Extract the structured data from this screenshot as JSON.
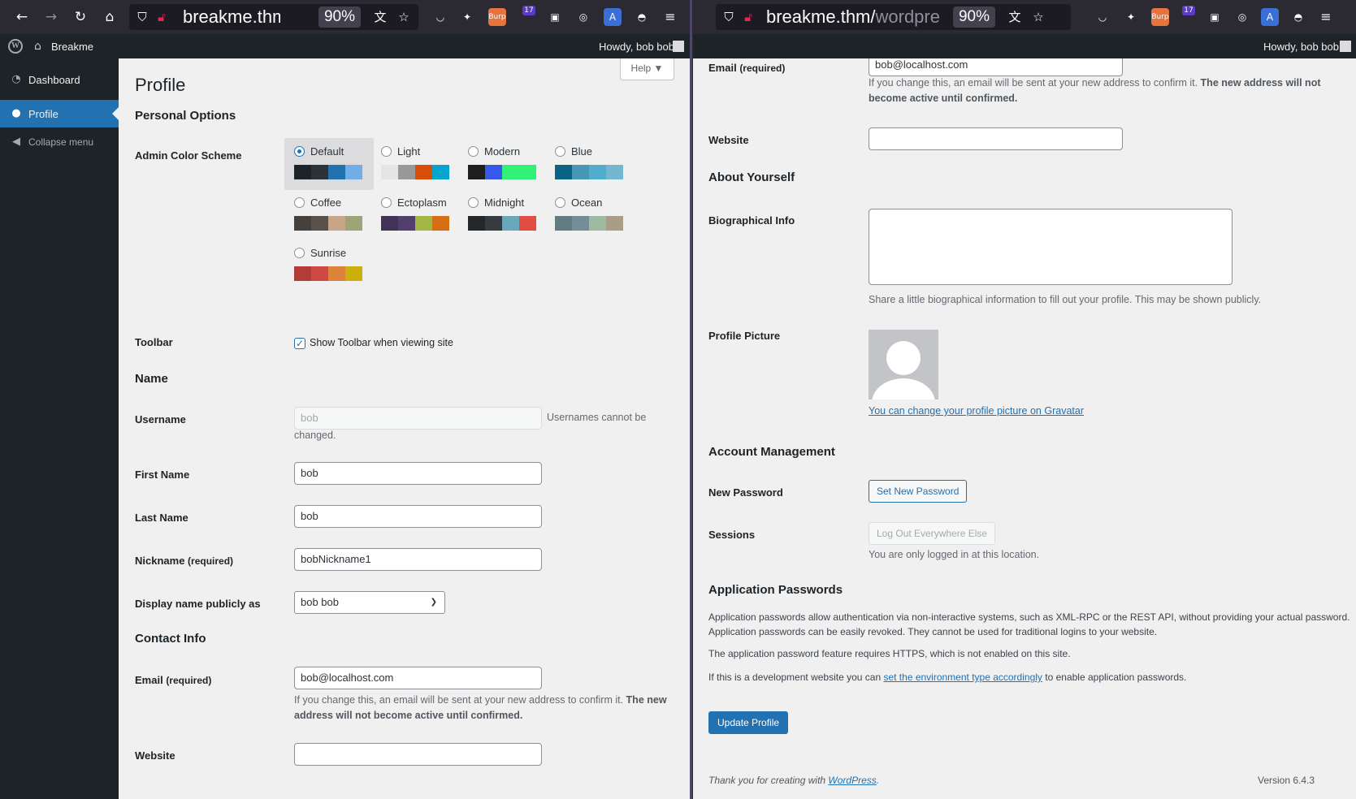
{
  "browser": {
    "left_url_host": "breakme.thm/",
    "left_url_path": "v",
    "right_url_host": "breakme.thm/",
    "right_url_path": "wordpre",
    "zoom": "90%",
    "ext_burp": "Burp",
    "ext_badge": "17"
  },
  "adminbar": {
    "site_name": "Breakme",
    "howdy": "Howdy, bob bob"
  },
  "sidebar": {
    "items": [
      {
        "label": "Dashboard"
      },
      {
        "label": "Profile"
      },
      {
        "label": "Collapse menu"
      }
    ]
  },
  "help_tab": "Help ▼",
  "page": {
    "title": "Profile",
    "section_personal": "Personal Options",
    "label_color_scheme": "Admin Color Scheme",
    "color_schemes": [
      {
        "name": "Default",
        "selected": true,
        "colors": [
          "#1d2327",
          "#2c3338",
          "#2271b1",
          "#72aee6"
        ]
      },
      {
        "name": "Light",
        "selected": false,
        "colors": [
          "#e5e5e5",
          "#999999",
          "#d64e07",
          "#04a4cc"
        ]
      },
      {
        "name": "Modern",
        "selected": false,
        "colors": [
          "#1e1e1e",
          "#3858e9",
          "#33f078",
          "#33f078"
        ]
      },
      {
        "name": "Blue",
        "selected": false,
        "colors": [
          "#096484",
          "#4796b3",
          "#52accc",
          "#74b6ce"
        ]
      },
      {
        "name": "Coffee",
        "selected": false,
        "colors": [
          "#46403c",
          "#59524c",
          "#c7a589",
          "#9ea476"
        ]
      },
      {
        "name": "Ectoplasm",
        "selected": false,
        "colors": [
          "#413256",
          "#523f6d",
          "#a3b745",
          "#d46f15"
        ]
      },
      {
        "name": "Midnight",
        "selected": false,
        "colors": [
          "#25282b",
          "#363b3f",
          "#69a8bb",
          "#e14d43"
        ]
      },
      {
        "name": "Ocean",
        "selected": false,
        "colors": [
          "#627c83",
          "#738e96",
          "#9ebaa0",
          "#aa9d88"
        ]
      },
      {
        "name": "Sunrise",
        "selected": false,
        "colors": [
          "#b43c38",
          "#cf4944",
          "#dd823b",
          "#ccaf0b"
        ]
      }
    ],
    "label_toolbar": "Toolbar",
    "toolbar_checkbox_label": "Show Toolbar when viewing site",
    "section_name": "Name",
    "label_username": "Username",
    "username_value": "bob",
    "username_note_1": "Usernames cannot be",
    "username_note_2": "changed.",
    "label_first_name": "First Name",
    "first_name_value": "bob",
    "label_last_name": "Last Name",
    "last_name_value": "bob",
    "label_nickname": "Nickname",
    "required": "(required)",
    "nickname_value": "bobNickname1",
    "label_display_name": "Display name publicly as",
    "display_name_value": "bob bob",
    "section_contact": "Contact Info",
    "label_email": "Email",
    "email_value": "bob@localhost.com",
    "email_note_plain": "If you change this, an email will be sent at your new address to confirm it.",
    "email_note_bold": "The new address will not become active until confirmed.",
    "email_note_left_1": "If you change this, an email will be sent at your new address to confirm it.",
    "email_note_left_bold_1": "The new",
    "email_note_left_bold_2": "address will not become active until confirmed.",
    "email_note_right_1": "If you change this, an email will be sent at your new address to confirm it.",
    "email_note_right_bold_1": "The new address will not",
    "email_note_right_bold_2": "become active until confirmed.",
    "label_website": "Website",
    "website_value": "",
    "section_about": "About Yourself",
    "label_bio": "Biographical Info",
    "bio_note": "Share a little biographical information to fill out your profile. This may be shown publicly.",
    "label_picture": "Profile Picture",
    "gravatar_link": "You can change your profile picture on Gravatar",
    "section_account": "Account Management",
    "label_new_password": "New Password",
    "set_password_button": "Set New Password",
    "label_sessions": "Sessions",
    "logout_button": "Log Out Everywhere Else",
    "sessions_note": "You are only logged in at this location.",
    "section_app_passwords": "Application Passwords",
    "app_pw_text_1": "Application passwords allow authentication via non-interactive systems, such as XML-RPC or the REST API, without providing your actual password.",
    "app_pw_text_2": "Application passwords can be easily revoked. They cannot be used for traditional logins to your website.",
    "app_pw_https": "The application password feature requires HTTPS, which is not enabled on this site.",
    "app_pw_dev_pre": "If this is a development website you can",
    "app_pw_dev_link": "set the environment type accordingly",
    "app_pw_dev_post": "to enable application passwords.",
    "update_button": "Update Profile",
    "footer_thanks_pre": "Thank you for creating with",
    "footer_thanks_link": "WordPress",
    "footer_version": "Version 6.4.3"
  }
}
